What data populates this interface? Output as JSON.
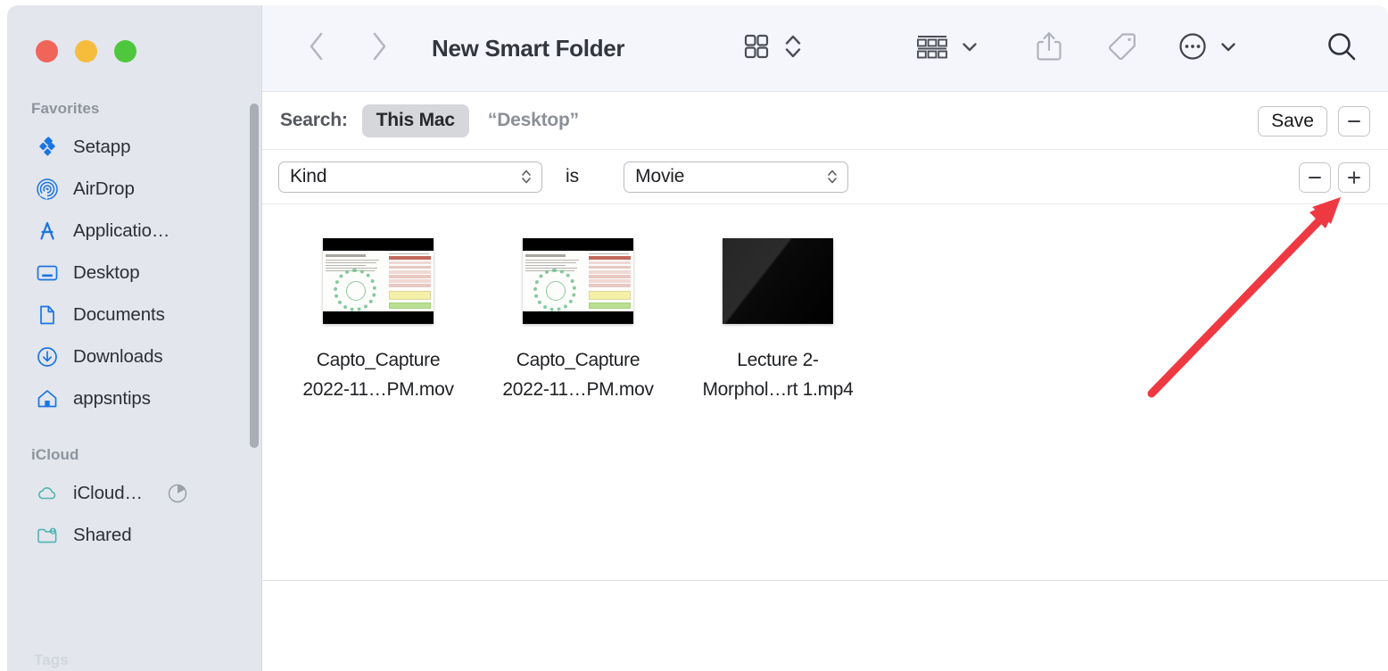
{
  "window": {
    "title": "New Smart Folder",
    "traffic_lights": [
      {
        "name": "close",
        "color": "#f0655a"
      },
      {
        "name": "minimize",
        "color": "#f6bd3d"
      },
      {
        "name": "zoom",
        "color": "#4fc73d"
      }
    ]
  },
  "toolbar": {
    "back_icon": "chevron-left-icon",
    "forward_icon": "chevron-right-icon",
    "view_icon": "icon-view-grid-icon",
    "view_sort_icon": "chevron-up-down-icon",
    "group_icon": "group-list-icon",
    "group_chevron_icon": "chevron-down-icon",
    "share_icon": "share-icon",
    "tag_icon": "tag-icon",
    "more_icon": "ellipsis-circle-icon",
    "more_chevron_icon": "chevron-down-icon",
    "search_icon": "search-icon"
  },
  "search_bar": {
    "label": "Search:",
    "scopes": [
      {
        "label": "This Mac",
        "selected": true
      },
      {
        "label": "“Desktop”",
        "selected": false
      }
    ],
    "save_label": "Save",
    "remove_label": "−"
  },
  "filter_row": {
    "attribute": "Kind",
    "operator": "is",
    "value": "Movie",
    "remove_label": "−",
    "add_label": "+"
  },
  "sidebar": {
    "sections": [
      {
        "title": "Favorites",
        "items": [
          {
            "label": "Setapp",
            "icon": "setapp-icon"
          },
          {
            "label": "AirDrop",
            "icon": "airdrop-icon"
          },
          {
            "label": "Applicatio…",
            "icon": "applications-icon"
          },
          {
            "label": "Desktop",
            "icon": "desktop-icon"
          },
          {
            "label": "Documents",
            "icon": "documents-icon"
          },
          {
            "label": "Downloads",
            "icon": "downloads-icon"
          },
          {
            "label": "appsntips",
            "icon": "home-icon"
          }
        ]
      },
      {
        "title": "iCloud",
        "items": [
          {
            "label": "iCloud…",
            "icon": "icloud-icon",
            "trailing_icon": "sync-progress-icon"
          },
          {
            "label": "Shared",
            "icon": "shared-folder-icon"
          }
        ]
      }
    ],
    "partial_section_title": "Tags"
  },
  "files": [
    {
      "name": "Capto_Capture\n2022-11…PM.mov",
      "thumbnail": "document-screenshot"
    },
    {
      "name": "Capto_Capture\n2022-11…PM.mov",
      "thumbnail": "document-screenshot"
    },
    {
      "name": "Lecture 2-\nMorphol…rt 1.mp4",
      "thumbnail": "black-video"
    }
  ],
  "annotation": {
    "type": "arrow",
    "color": "#ef3942",
    "points_to": "add-filter-row-button"
  },
  "colors": {
    "sidebar_bg": "#e3e6ec",
    "toolbar_bg": "#f4f6fb",
    "content_bg": "#ffffff",
    "accent_blue": "#1b74e3",
    "icloud_teal": "#4eb5b5",
    "annotation_red": "#ef3942"
  }
}
